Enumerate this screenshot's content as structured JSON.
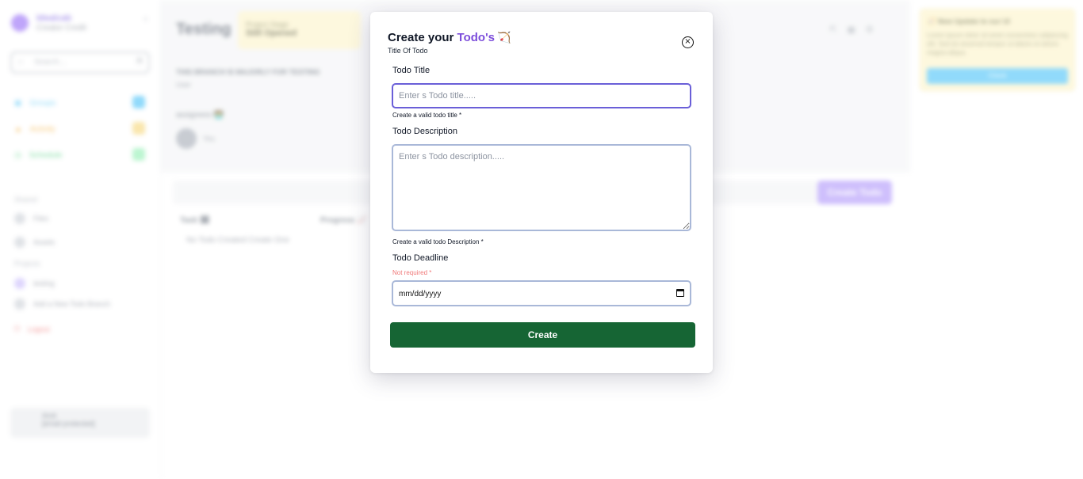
{
  "background": {
    "sidebar": {
      "workspace_name": "Idealcab",
      "workspace_sub": "Creator Credit",
      "search_placeholder": "Search...",
      "search_shortcut": "⌘",
      "nav_items": [
        {
          "label": "Groups",
          "color": "#38bdf8"
        },
        {
          "label": "Activity",
          "color": "#f59e0b"
        },
        {
          "label": "Schedule",
          "color": "#22c55e"
        }
      ],
      "shared_heading": "Shared",
      "shared_items": [
        "Files",
        "Assets"
      ],
      "projects_heading": "Projects",
      "project_items": [
        "testing",
        "Add a New Todo Branch"
      ],
      "logout_label": "Logout",
      "user_name": "Amit",
      "user_email": "[email protected]"
    },
    "header": {
      "page_title": "Testing",
      "stage_label": "Project Stage",
      "stage_value": "Still Opened",
      "branch_note": "THIS BRANCH IS MAJORLY FOR TESTING",
      "branch_user": "User",
      "assignees_label": "assignees 🧑‍💻",
      "assignee_name": "You"
    },
    "create_todo_button": "Create Todo",
    "columns": [
      "Task 🗓",
      "Progress 📈"
    ],
    "empty_message": "No Todo Created Create One",
    "promo": {
      "title": "🧭 New Update to our UI",
      "body": "Lorem ipsum dolor sit amet consectetur adipiscing elit. Sed do eiusmod tempor ut labore et dolore magna aliqua.",
      "button": "Check"
    }
  },
  "modal": {
    "title_prefix": "Create your ",
    "title_accent": "Todo's",
    "title_emoji": "🏹",
    "subtitle": "Title Of Todo",
    "title_label": "Todo Title",
    "title_placeholder": "Enter s Todo title.....",
    "title_hint": "Create a valid todo title *",
    "desc_label": "Todo Description",
    "desc_placeholder": "Enter s Todo description.....",
    "desc_hint": "Create a valid todo Description *",
    "deadline_label": "Todo Deadline",
    "deadline_hint": "Not required *",
    "deadline_value": "mm/dd/yyyy",
    "create_button": "Create",
    "close_symbol": "×"
  },
  "colors": {
    "accent": "#7c4ddb",
    "create_button": "#166534",
    "focus_border": "#6a5fd8",
    "hint_red": "#f07878"
  }
}
